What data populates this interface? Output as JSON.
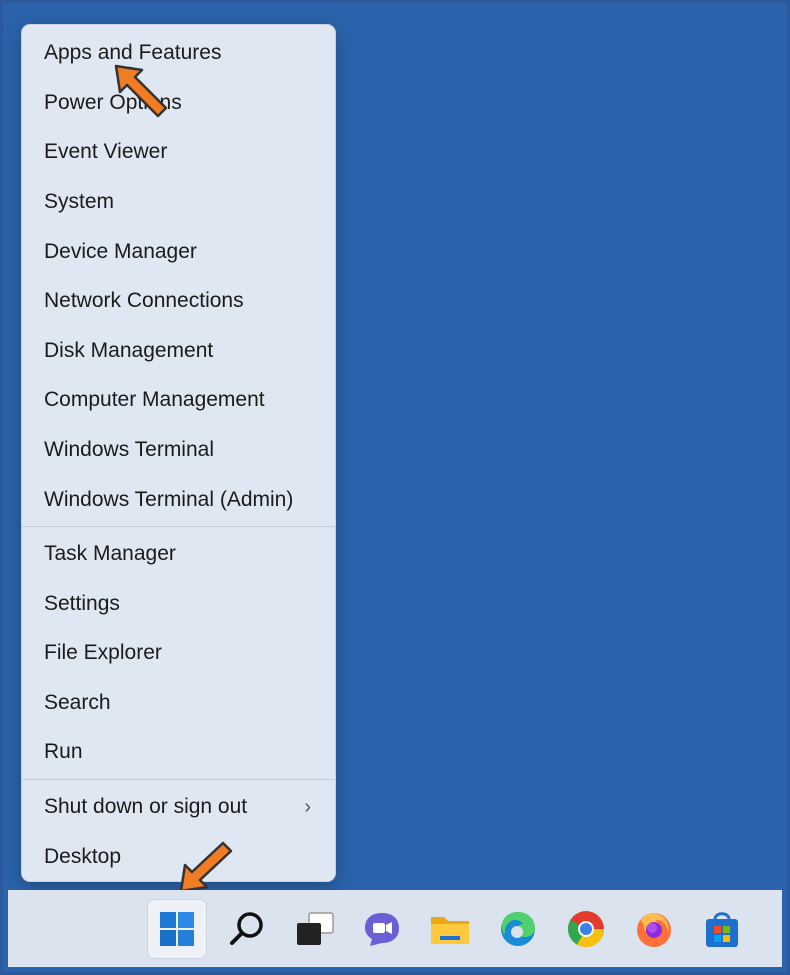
{
  "menu": {
    "group1": [
      {
        "label": "Apps and Features"
      },
      {
        "label": "Power Options"
      },
      {
        "label": "Event Viewer"
      },
      {
        "label": "System"
      },
      {
        "label": "Device Manager"
      },
      {
        "label": "Network Connections"
      },
      {
        "label": "Disk Management"
      },
      {
        "label": "Computer Management"
      },
      {
        "label": "Windows Terminal"
      },
      {
        "label": "Windows Terminal (Admin)"
      }
    ],
    "group2": [
      {
        "label": "Task Manager"
      },
      {
        "label": "Settings"
      },
      {
        "label": "File Explorer"
      },
      {
        "label": "Search"
      },
      {
        "label": "Run"
      }
    ],
    "group3": [
      {
        "label": "Shut down or sign out",
        "chevron": "›"
      },
      {
        "label": "Desktop"
      }
    ]
  },
  "taskbar": {
    "items": [
      {
        "icon": "windows-start-icon"
      },
      {
        "icon": "search-icon"
      },
      {
        "icon": "task-view-icon"
      },
      {
        "icon": "teams-chat-icon"
      },
      {
        "icon": "file-explorer-icon"
      },
      {
        "icon": "edge-icon"
      },
      {
        "icon": "chrome-icon"
      },
      {
        "icon": "firefox-icon"
      },
      {
        "icon": "store-icon"
      }
    ]
  },
  "colors": {
    "desktop": "#2b64ad",
    "menu_bg": "#dfe7f2",
    "taskbar_bg": "#dbe3ee",
    "annotation_arrow": "#f07c24"
  }
}
